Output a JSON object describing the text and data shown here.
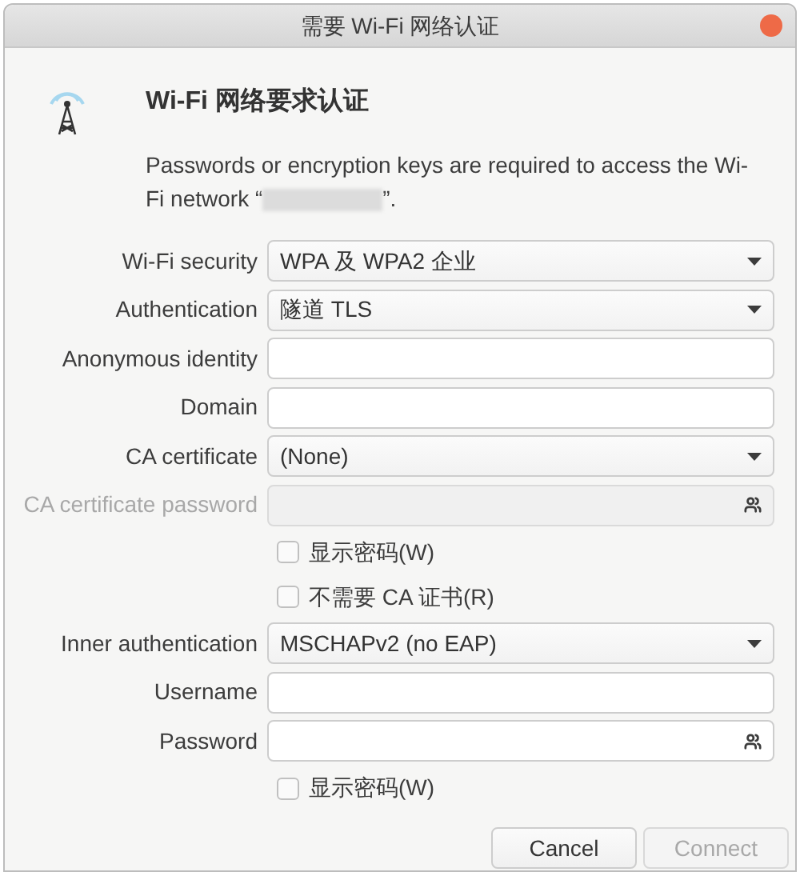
{
  "window": {
    "title": "需要 Wi-Fi 网络认证"
  },
  "heading": "Wi-Fi 网络要求认证",
  "message": {
    "line_1": "Passwords or encryption keys are required to access the Wi-",
    "before": "Fi network “",
    "after": "”."
  },
  "rows": [
    {
      "kind": "select",
      "label": "Wi-Fi security",
      "value": "WPA 及 WPA2 企业",
      "disabled": false
    },
    {
      "kind": "select",
      "label": "Authentication",
      "value": "隧道 TLS",
      "disabled": false
    },
    {
      "kind": "entry",
      "label": "Anonymous identity",
      "disabled": false
    },
    {
      "kind": "entry",
      "label": "Domain",
      "disabled": false
    },
    {
      "kind": "select",
      "label": "CA certificate",
      "value": "(None)",
      "disabled": false
    },
    {
      "kind": "password",
      "label": "CA certificate password",
      "disabled": true
    },
    {
      "kind": "checkbox",
      "label": "显示密码(W)",
      "checked": false,
      "disabled": false
    },
    {
      "kind": "checkbox",
      "label": "不需要 CA 证书(R)",
      "checked": false,
      "disabled": false
    },
    {
      "kind": "select",
      "label": "Inner authentication",
      "value": "MSCHAPv2 (no EAP)",
      "disabled": false
    },
    {
      "kind": "entry",
      "label": "Username",
      "disabled": false
    },
    {
      "kind": "password",
      "label": "Password",
      "disabled": false
    },
    {
      "kind": "checkbox",
      "label": "显示密码(W)",
      "checked": false,
      "disabled": false
    }
  ],
  "buttons": [
    {
      "label": "Cancel",
      "disabled": false
    },
    {
      "label": "Connect",
      "disabled": true
    }
  ]
}
